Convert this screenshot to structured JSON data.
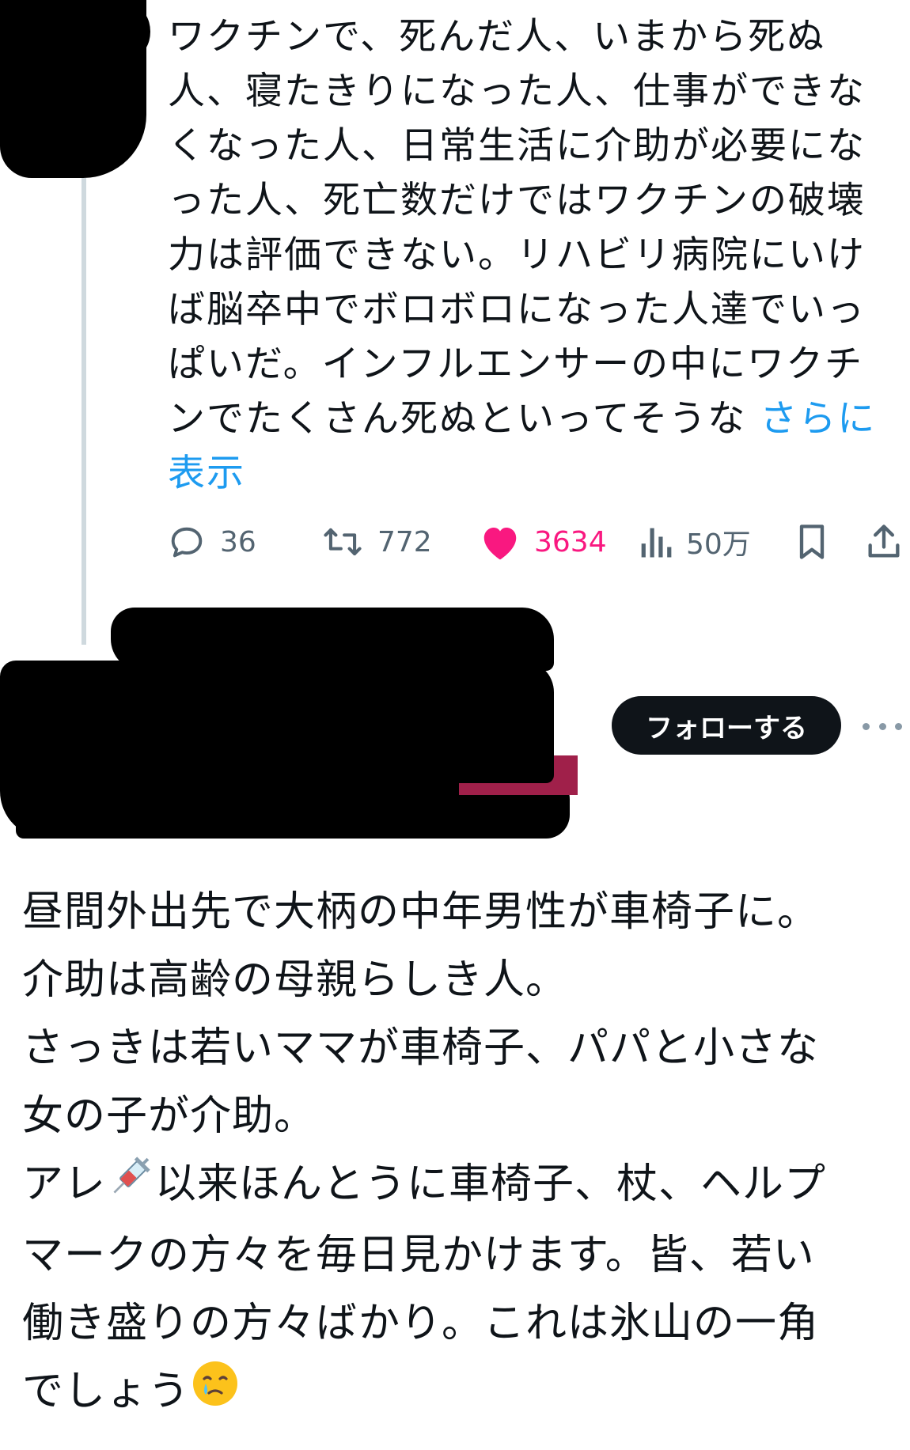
{
  "tweet1": {
    "text": "ワクチンで、死んだ人、いまから死ぬ人、寝たきりになった人、仕事ができなくなった人、日常生活に介助が必要になった人、死亡数だけではワクチンの破壊力は評価できない。リハビリ病院にいけば脳卒中でボロボロになった人達でいっぱいだ。インフルエンサーの中にワクチンでたくさん死ぬといってそうな",
    "more_label": "さらに表示",
    "actions": {
      "replies": "36",
      "reposts": "772",
      "likes": "3634",
      "views": "50万"
    },
    "colors": {
      "like": "#f91880",
      "link": "#1d9bf0",
      "icon": "#536471"
    },
    "icons": [
      "reply-icon",
      "repost-icon",
      "heart-icon",
      "views-icon",
      "bookmark-icon",
      "share-icon"
    ]
  },
  "tweet2": {
    "follow_label": "フォローする",
    "lines": [
      "昼間外出先で大柄の中年男性が車椅子に。",
      "介助は高齢の母親らしき人。",
      "さっきは若いママが車椅子、パパと小さな",
      "女の子が介助。",
      "アレ",
      "以来ほんとうに車椅子、杖、ヘルプ",
      "マークの方々を毎日見かけます。皆、若い",
      "働き盛りの方々ばかり。これは氷山の一角",
      "でしょう"
    ],
    "icons": [
      "syringe-icon",
      "crying-face-icon",
      "more-icon"
    ]
  }
}
